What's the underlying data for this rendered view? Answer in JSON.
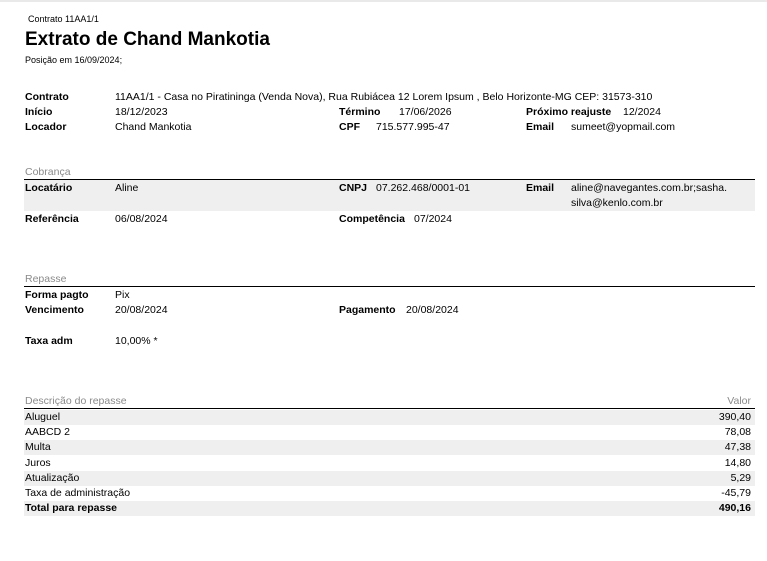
{
  "header": {
    "contract_ref": "Contrato 11AA1/1",
    "title": "Extrato de Chand Mankotia",
    "position_date": "Posição em 16/09/2024;"
  },
  "contract": {
    "contrato_label": "Contrato",
    "contrato_value": "11AA1/1 - Casa no Piratininga (Venda Nova), Rua Rubiácea 12  Lorem Ipsum , Belo Horizonte-MG CEP: 31573-310",
    "inicio_label": "Início",
    "inicio_value": "18/12/2023",
    "termino_label": "Término",
    "termino_value": "17/06/2026",
    "reajuste_label": "Próximo reajuste",
    "reajuste_value": "12/2024",
    "locador_label": "Locador",
    "locador_value": "Chand Mankotia",
    "cpf_label": "CPF",
    "cpf_value": "715.577.995-47",
    "email_label": "Email",
    "email_value": "sumeet@yopmail.com"
  },
  "cobranca": {
    "section_title": "Cobrança",
    "locatario_label": "Locatário",
    "locatario_value": "Aline",
    "cnpj_label": "CNPJ",
    "cnpj_value": "07.262.468/0001-01",
    "email_label": "Email",
    "email_line1": "aline@navegantes.com.br;sasha.",
    "email_line2": "silva@kenlo.com.br",
    "referencia_label": "Referência",
    "referencia_value": "06/08/2024",
    "competencia_label": "Competência",
    "competencia_value": "07/2024"
  },
  "repasse": {
    "section_title": "Repasse",
    "forma_label": "Forma pagto",
    "forma_value": "Pix",
    "vencimento_label": "Vencimento",
    "vencimento_value": "20/08/2024",
    "pagamento_label": "Pagamento",
    "pagamento_value": "20/08/2024",
    "taxa_label": "Taxa adm",
    "taxa_value": "10,00% *"
  },
  "descricao": {
    "header_desc": "Descrição do repasse",
    "header_valor": "Valor",
    "rows": [
      {
        "label": "Aluguel",
        "value": "390,40"
      },
      {
        "label": "AABCD 2",
        "value": "78,08"
      },
      {
        "label": "Multa",
        "value": "47,38"
      },
      {
        "label": "Juros",
        "value": "14,80"
      },
      {
        "label": "Atualização",
        "value": "5,29"
      },
      {
        "label": "Taxa de administração",
        "value": "-45,79"
      }
    ],
    "total_label": "Total para repasse",
    "total_value": "490,16"
  }
}
